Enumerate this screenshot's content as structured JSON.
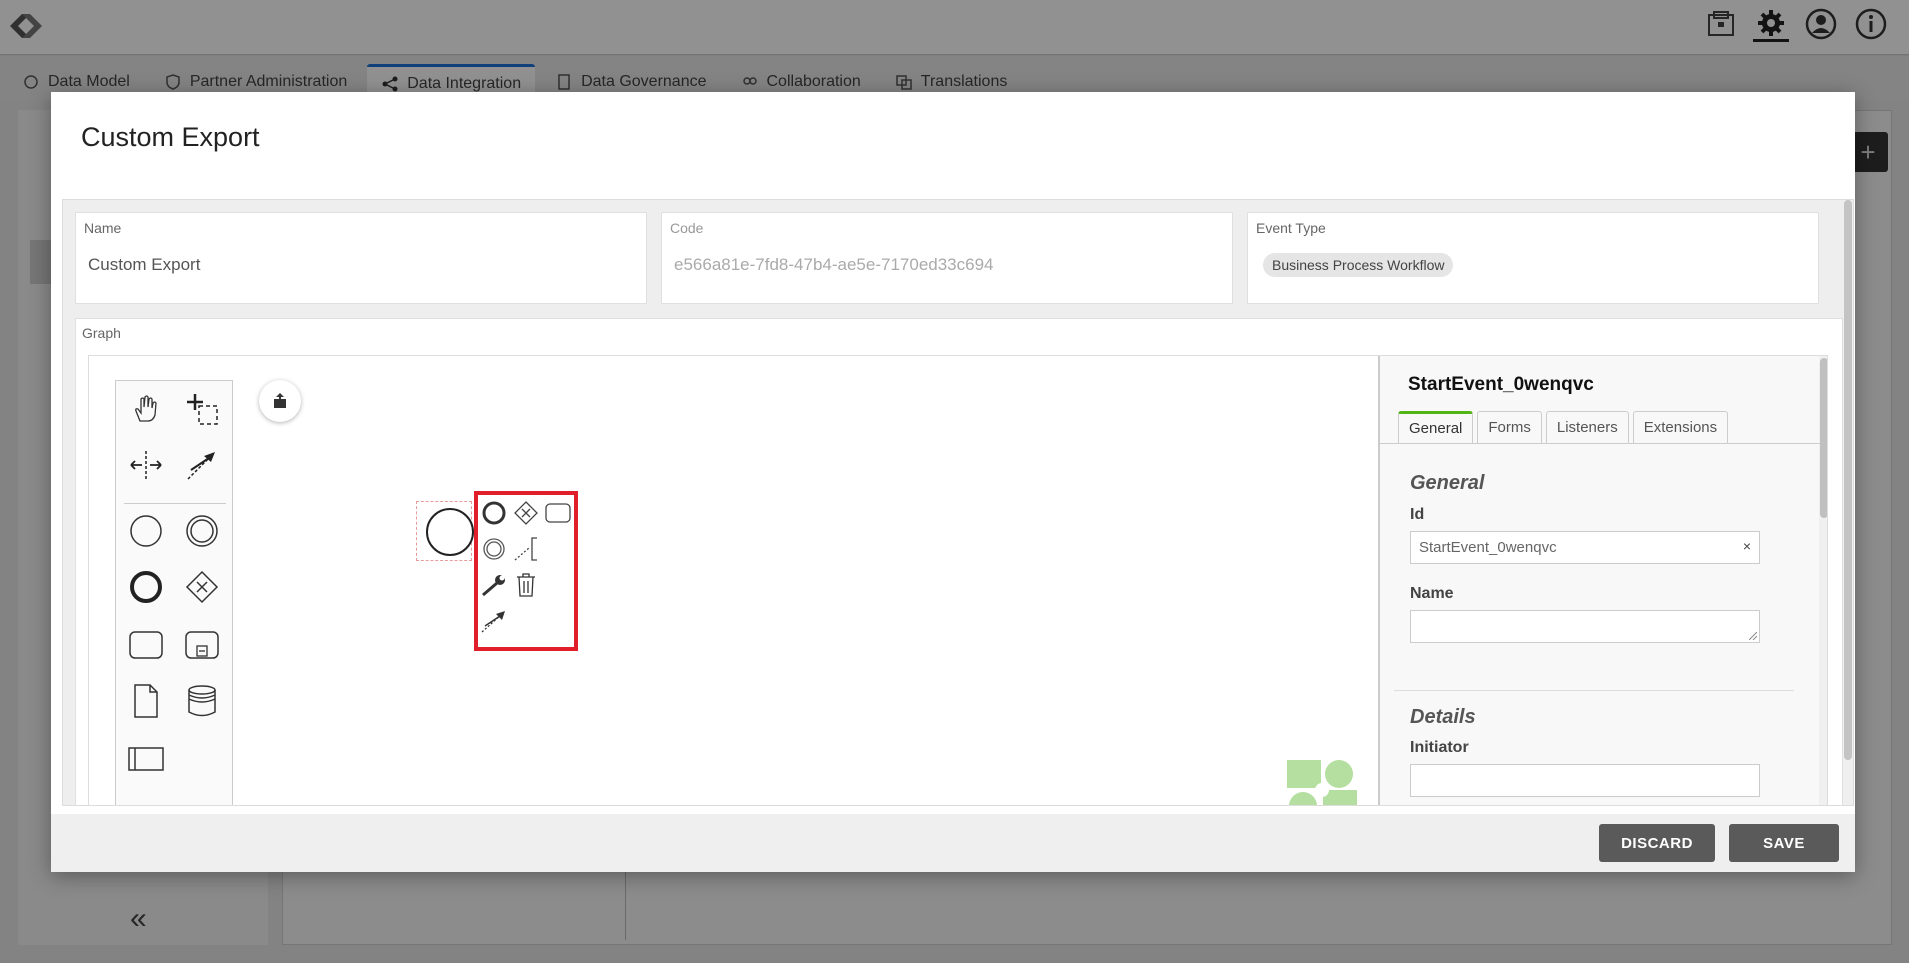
{
  "app": {
    "tabs": [
      {
        "label": "Data Model",
        "icon": "data-model-icon"
      },
      {
        "label": "Partner Administration",
        "icon": "shield-icon"
      },
      {
        "label": "Data Integration",
        "icon": "integration-icon"
      },
      {
        "label": "Data Governance",
        "icon": "governance-icon"
      },
      {
        "label": "Collaboration",
        "icon": "collaboration-icon"
      },
      {
        "label": "Translations",
        "icon": "translations-icon"
      }
    ],
    "active_tab": "Data Integration",
    "top_icons": [
      "inbox-icon",
      "gear-icon",
      "user-icon",
      "info-icon"
    ],
    "accent_color": "#1f6fd6"
  },
  "modal": {
    "title": "Custom Export",
    "fields": {
      "name": {
        "label": "Name",
        "value": "Custom Export"
      },
      "code": {
        "label": "Code",
        "value": "e566a81e-7fd8-47b4-ae5e-7170ed33c694"
      },
      "event_type": {
        "label": "Event Type",
        "value": "Business Process Workflow"
      }
    },
    "graph_label": "Graph",
    "palette_tools": [
      "hand-tool-icon",
      "lasso-tool-icon",
      "space-tool-icon",
      "global-connect-icon",
      "start-event-icon",
      "intermediate-event-icon",
      "end-event-icon",
      "gateway-icon",
      "task-icon",
      "subprocess-icon",
      "data-object-icon",
      "data-store-icon",
      "pool-icon"
    ],
    "context_pad": [
      "append-end-event-icon",
      "append-gateway-icon",
      "append-task-icon",
      "append-intermediate-event-icon",
      "text-annotation-icon",
      "change-type-wrench-icon",
      "delete-trash-icon",
      "connect-arrow-icon"
    ],
    "highlight_color": "#e01f2b",
    "properties": {
      "title": "StartEvent_0wenqvc",
      "tabs": [
        "General",
        "Forms",
        "Listeners",
        "Extensions"
      ],
      "active_tab": "General",
      "general_title": "General",
      "id_label": "Id",
      "id_value": "StartEvent_0wenqvc",
      "clear_symbol": "×",
      "name_label": "Name",
      "name_value": "",
      "details_title": "Details",
      "initiator_label": "Initiator",
      "initiator_value": ""
    },
    "buttons": {
      "discard": "DISCARD",
      "save": "SAVE"
    }
  },
  "background": {
    "collapse_symbol": "«",
    "plus_symbol": "+"
  }
}
